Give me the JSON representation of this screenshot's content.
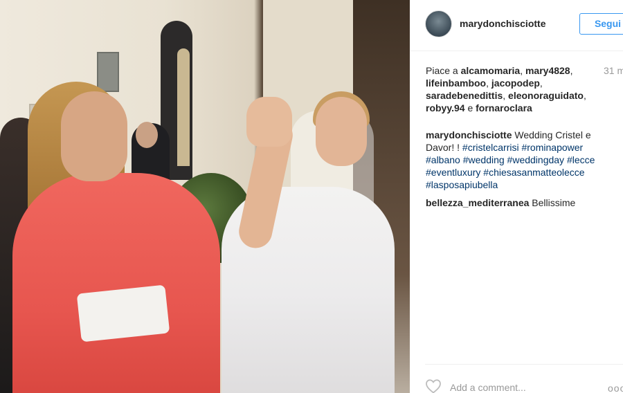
{
  "post": {
    "username": "marydonchisciotte",
    "follow_label": "Segui",
    "time": "31 m",
    "likes_prefix": "Piace a",
    "likers": [
      "alcamomaria",
      "mary4828",
      "lifeinbamboo",
      "jacopodep",
      "saradebenedittis",
      "eleonoraguidato",
      "robyy.94",
      "fornaroclara"
    ],
    "likes_joiner": "e",
    "caption_text": "Wedding Cristel e Davor! !",
    "hashtags": [
      "#cristelcarrisi",
      "#rominapower",
      "#albano",
      "#wedding",
      "#weddingday",
      "#lecce",
      "#eventluxury",
      "#chiesasanmatteolecce",
      "#lasposapiubella"
    ],
    "comments": [
      {
        "username": "bellezza_mediterranea",
        "text": "Bellissime"
      }
    ],
    "add_comment_placeholder": "Add a comment...",
    "more_label": "ooo"
  },
  "icons": {
    "avatar": "profile-avatar",
    "like": "heart-outline-icon",
    "options": "more-options-icon"
  },
  "colors": {
    "follow_blue": "#3897f0",
    "hashtag": "#003569",
    "muted": "#999999"
  }
}
